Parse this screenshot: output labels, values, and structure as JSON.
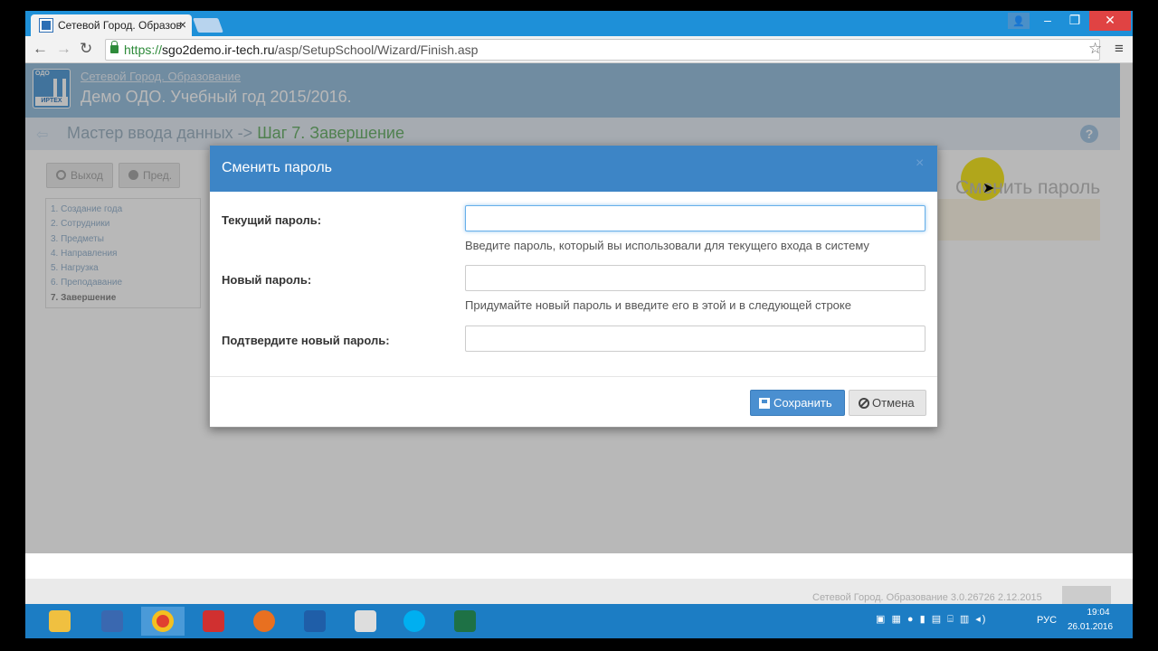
{
  "browser": {
    "tab_title": "Сетевой Город. Образов",
    "url_scheme": "https://",
    "url_host": "sgo2demo.ir-tech.ru",
    "url_path": "/asp/SetupSchool/Wizard/Finish.asp"
  },
  "header": {
    "logo_top": "ОДО",
    "logo_bottom": "ИРТЕХ",
    "brand": "Сетевой Город. Образование",
    "school_year": "Демо ОДО. Учебный год 2015/2016."
  },
  "wizard": {
    "title": "Мастер ввода данных ->",
    "step": "Шаг 7. Завершение",
    "help": "?"
  },
  "toolbar": {
    "exit_label": "Выход",
    "prev_label": "Пред."
  },
  "steps": [
    "1. Создание года",
    "2. Сотрудники",
    "3. Предметы",
    "4. Направления",
    "5. Нагрузка",
    "6. Преподавание",
    "7. Завершение"
  ],
  "change_password_link": "Сменить пароль",
  "modal": {
    "title": "Сменить пароль",
    "close": "×",
    "current_label": "Текущий пароль:",
    "current_hint": "Введите пароль, который вы использовали для текущего входа в систему",
    "new_label": "Новый пароль:",
    "new_hint": "Придумайте новый пароль и введите его в этой и в следующей строке",
    "confirm_label": "Подтвердите новый пароль:",
    "save_label": "Сохранить",
    "cancel_label": "Отмена"
  },
  "footer": {
    "version": "Сетевой Город. Образование  3.0.26726  2.12.2015"
  },
  "taskbar": {
    "lang": "РУС",
    "time": "19:04",
    "date": "26.01.2016"
  },
  "colors": {
    "accent": "#3d85c6",
    "header": "#9cc2e0",
    "taskbar": "#1c7dc4"
  }
}
